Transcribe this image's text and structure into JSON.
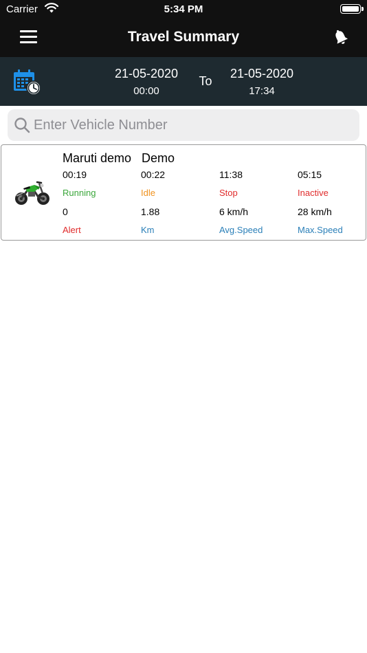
{
  "status_bar": {
    "carrier": "Carrier",
    "time": "5:34 PM"
  },
  "header": {
    "title": "Travel Summary"
  },
  "date_range": {
    "from_date": "21-05-2020",
    "from_time": "00:00",
    "to_label": "To",
    "to_date": "21-05-2020",
    "to_time": "17:34"
  },
  "search": {
    "placeholder": "Enter Vehicle Number",
    "value": ""
  },
  "vehicles": [
    {
      "name": "Maruti demo",
      "group": "Demo",
      "running": {
        "value": "00:19",
        "label": "Running"
      },
      "idle": {
        "value": "00:22",
        "label": "Idle"
      },
      "stop": {
        "value": "11:38",
        "label": "Stop"
      },
      "inactive": {
        "value": "05:15",
        "label": "Inactive"
      },
      "alert": {
        "value": "0",
        "label": "Alert"
      },
      "km": {
        "value": "1.88",
        "label": "Km"
      },
      "avg_speed": {
        "value": "6 km/h",
        "label": "Avg.Speed"
      },
      "max_speed": {
        "value": "28 km/h",
        "label": "Max.Speed"
      }
    }
  ],
  "colors": {
    "running": "#3aa63a",
    "idle": "#f0921e",
    "stop": "#e02b2b",
    "inactive": "#e02b2b",
    "alert": "#e02b2b",
    "info": "#2a7fb8",
    "calendar_icon": "#1e90e8",
    "nav_bg": "#111111",
    "datebar_bg": "#1e2a30"
  },
  "icons": [
    "menu-icon",
    "bell-icon",
    "calendar-clock-icon",
    "search-icon",
    "motorcycle-icon",
    "wifi-icon",
    "battery-icon"
  ]
}
